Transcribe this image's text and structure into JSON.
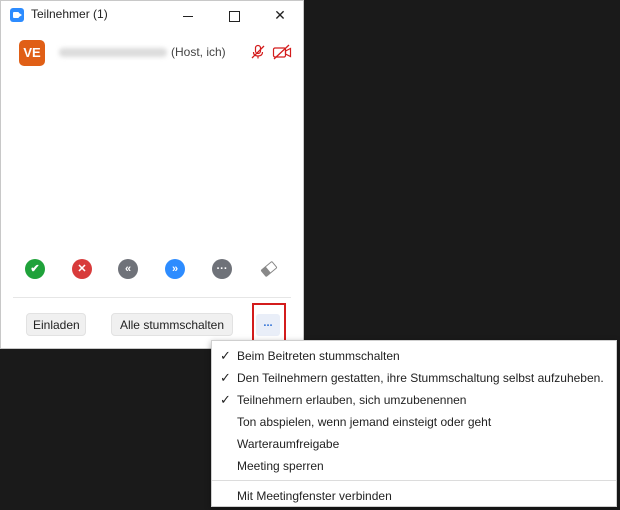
{
  "window": {
    "title": "Teilnehmer (1)",
    "controls": {
      "minimize": "minimize",
      "maximize": "maximize",
      "close": "✕"
    }
  },
  "participant": {
    "avatar_initials": "VE",
    "host_label": "(Host, ich)",
    "icons": [
      "mic-off-icon",
      "camera-off-icon"
    ],
    "accent_color": "#e05f16",
    "status_color": "#d31c1c"
  },
  "reactions": [
    {
      "name": "yes",
      "glyph": "✔",
      "color": "#1fa23a"
    },
    {
      "name": "no",
      "glyph": "✕",
      "color": "#d83b3b"
    },
    {
      "name": "go-slower",
      "glyph": "«",
      "color": "#6f7279"
    },
    {
      "name": "go-faster",
      "glyph": "»",
      "color": "#2d8cff"
    },
    {
      "name": "more",
      "glyph": "···",
      "color": "#6f7279"
    },
    {
      "name": "clear-all",
      "glyph": "eraser"
    }
  ],
  "footer": {
    "invite_label": "Einladen",
    "mute_all_label": "Alle stummschalten",
    "more_label": "..."
  },
  "menu": {
    "items": [
      {
        "label": "Beim Beitreten stummschalten",
        "checked": true,
        "check": "✓"
      },
      {
        "label": "Den Teilnehmern gestatten, ihre Stummschaltung selbst aufzuheben.",
        "checked": true,
        "check": "✓"
      },
      {
        "label": "Teilnehmern erlauben, sich umzubenennen",
        "checked": true,
        "check": "✓"
      },
      {
        "label": "Ton abspielen, wenn jemand einsteigt oder geht",
        "checked": false,
        "check": ""
      },
      {
        "label": "Warteraumfreigabe",
        "checked": false,
        "check": ""
      },
      {
        "label": "Meeting sperren",
        "checked": false,
        "check": ""
      }
    ],
    "footer_item": "Mit Meetingfenster verbinden"
  }
}
